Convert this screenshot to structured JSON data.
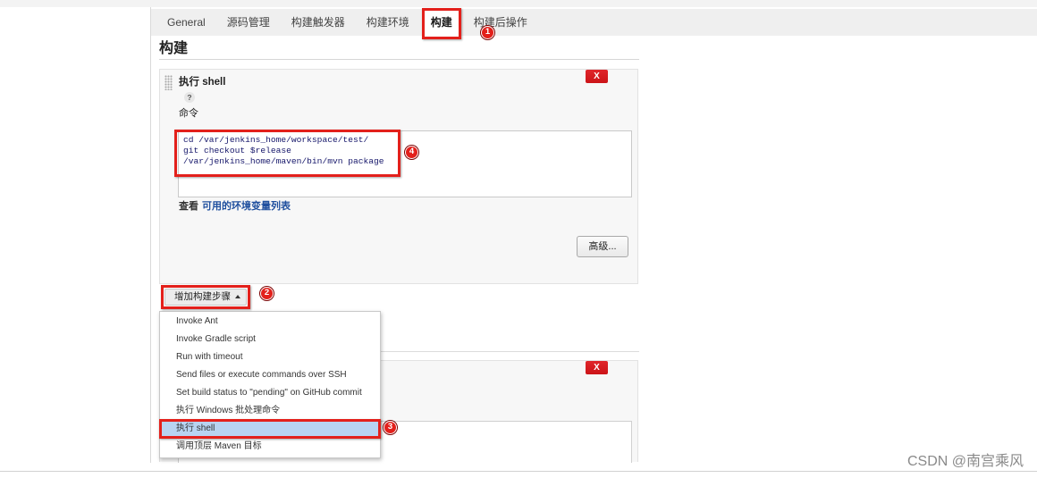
{
  "tabs": [
    {
      "label": "General"
    },
    {
      "label": "源码管理"
    },
    {
      "label": "构建触发器"
    },
    {
      "label": "构建环境"
    },
    {
      "label": "构建"
    },
    {
      "label": "构建后操作"
    }
  ],
  "active_tab_index": 4,
  "section_title": "构建",
  "build_step": {
    "delete_label": "X",
    "title": "执行 shell",
    "help_label": "?",
    "command_label": "命令",
    "command": "cd /var/jenkins_home/workspace/test/\ngit checkout $release\n/var/jenkins_home/maven/bin/mvn package",
    "env_prefix": "查看",
    "env_link": "可用的环境变量列表",
    "advanced_label": "高级..."
  },
  "add_step": {
    "label": "增加构建步骤",
    "menu_items": [
      "Invoke Ant",
      "Invoke Gradle script",
      "Run with timeout",
      "Send files or execute commands over SSH",
      "Set build status to \"pending\" on GitHub commit",
      "执行 Windows 批处理命令",
      "执行 shell",
      "调用顶层 Maven 目标"
    ],
    "highlighted_index": 6
  },
  "second_step": {
    "delete_label": "X"
  },
  "annotations": {
    "tab_marker": "1",
    "add_step_marker": "2",
    "menu_item_marker": "3",
    "command_marker": "4"
  },
  "watermark": "CSDN @南宫乘风",
  "colors": {
    "annotation_red": "#e3201b",
    "delete_red": "#cc1418",
    "link_blue": "#1f4f9e",
    "tab_bar": "#efefef",
    "menu_highlight": "#b8d3f1",
    "command_text": "#15166a"
  }
}
